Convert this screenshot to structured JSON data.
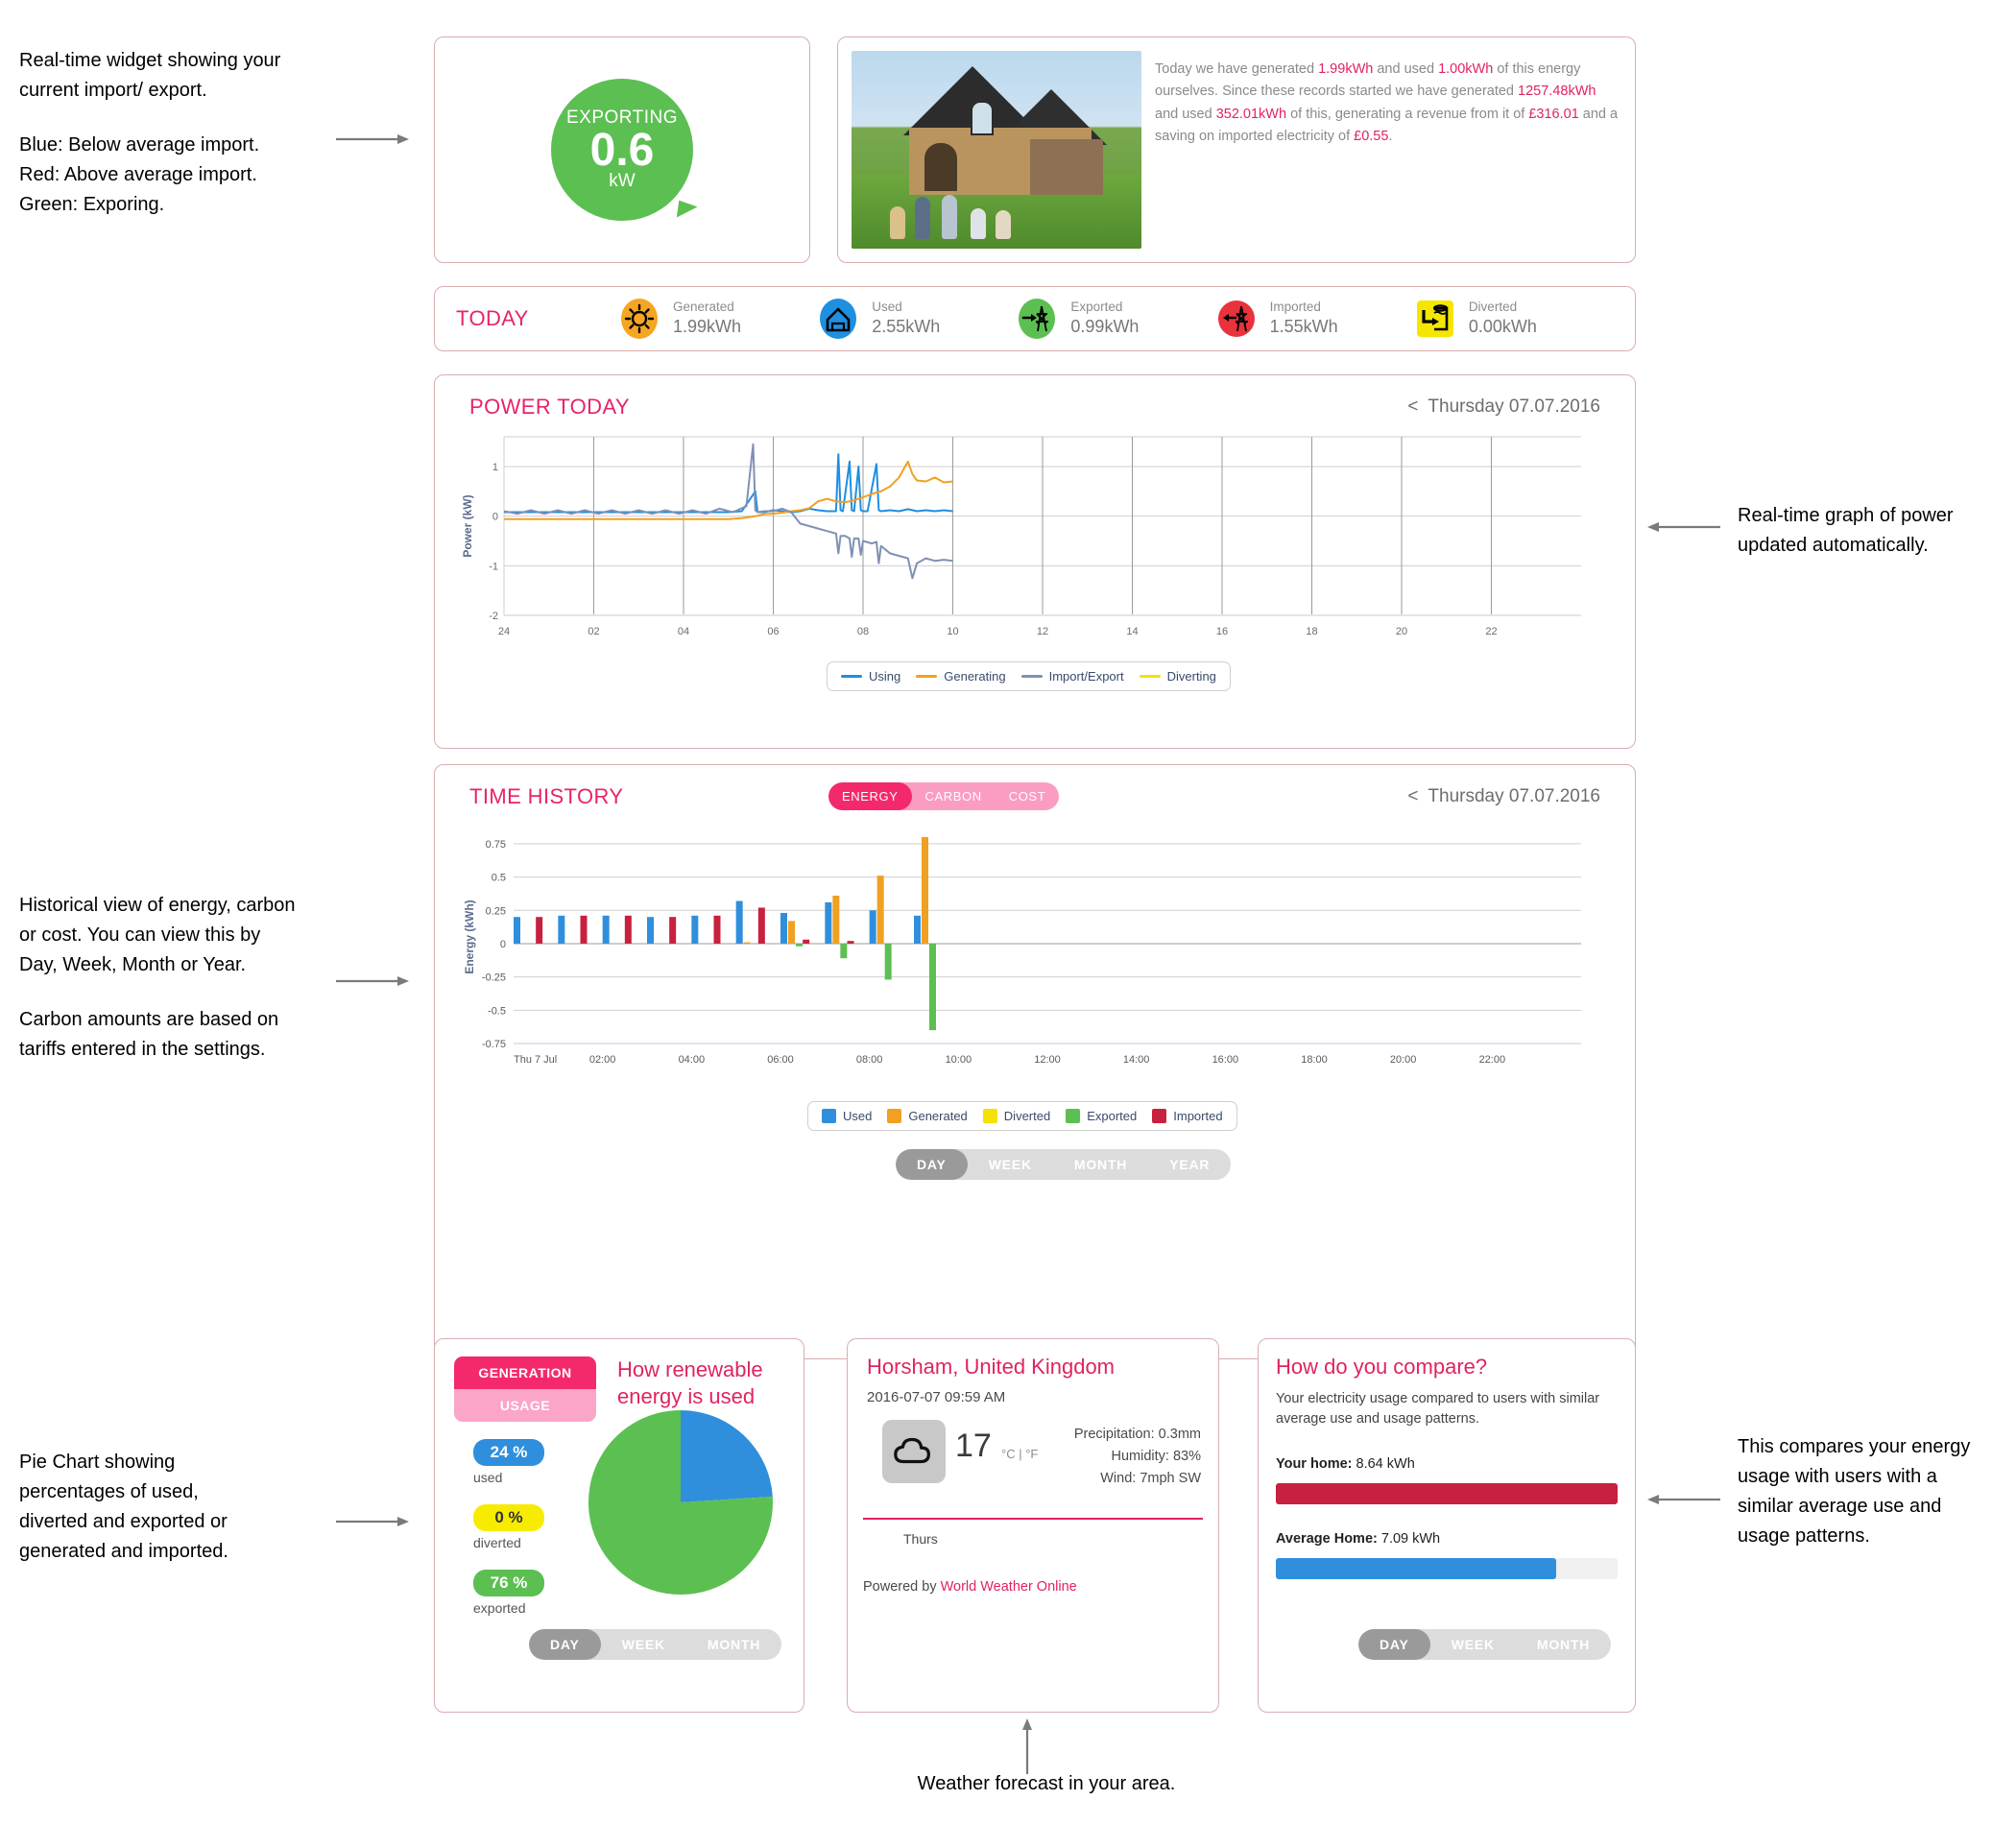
{
  "annotations": {
    "widget": [
      "Real-time widget showing your",
      "current import/ export.",
      "Blue: Below average import.",
      "Red: Above average import.",
      "Green: Exporing."
    ],
    "power_graph": [
      "Real-time graph of power",
      "updated automatically."
    ],
    "history": [
      "Historical view of energy, carbon",
      "or cost. You can view this by",
      "Day, Week, Month or Year.",
      "Carbon amounts are based on",
      "tariffs entered in the settings."
    ],
    "pie": [
      "Pie Chart showing",
      "percentages of used,",
      "diverted and exported or",
      "generated and imported."
    ],
    "compare": [
      "This compares your energy",
      "usage with users with a",
      "similar average use and",
      "usage patterns."
    ],
    "weather": "Weather forecast in your area."
  },
  "realtime": {
    "state": "EXPORTING",
    "value": "0.6",
    "unit": "kW",
    "color": "#5cbf52"
  },
  "summary": {
    "parts": [
      {
        "t": "Today we have generated ",
        "hl": false
      },
      {
        "t": "1.99kWh",
        "hl": true
      },
      {
        "t": " and used ",
        "hl": false
      },
      {
        "t": "1.00kWh",
        "hl": true
      },
      {
        "t": " of this energy ourselves. Since these records started we have generated ",
        "hl": false
      },
      {
        "t": "1257.48kWh",
        "hl": true
      },
      {
        "t": " and used ",
        "hl": false
      },
      {
        "t": "352.01kWh",
        "hl": true
      },
      {
        "t": " of this, generating a revenue from it of ",
        "hl": false
      },
      {
        "t": "£316.01",
        "hl": true
      },
      {
        "t": " and a saving on imported electricity of ",
        "hl": false
      },
      {
        "t": "£0.55",
        "hl": true
      },
      {
        "t": ".",
        "hl": false
      }
    ]
  },
  "today": {
    "title": "TODAY",
    "stats": [
      {
        "label": "Generated",
        "value": "1.99kWh",
        "icon": "sun-icon",
        "color": "#f5a623"
      },
      {
        "label": "Used",
        "value": "2.55kWh",
        "icon": "house-icon",
        "color": "#1f8fe0"
      },
      {
        "label": "Exported",
        "value": "0.99kWh",
        "icon": "pylon-export-icon",
        "color": "#5cbf52"
      },
      {
        "label": "Imported",
        "value": "1.55kWh",
        "icon": "pylon-import-icon",
        "color": "#e8323c"
      },
      {
        "label": "Diverted",
        "value": "0.00kWh",
        "icon": "tank-icon",
        "color": "#f5e600"
      }
    ]
  },
  "power_panel": {
    "title": "POWER TODAY",
    "date": "Thursday 07.07.2016",
    "chevron": "<"
  },
  "history_panel": {
    "title": "TIME HISTORY",
    "date": "Thursday 07.07.2016",
    "chevron": "<",
    "metric_tabs": [
      {
        "label": "ENERGY",
        "active": true
      },
      {
        "label": "CARBON",
        "active": false
      },
      {
        "label": "COST",
        "active": false
      }
    ],
    "range_tabs": [
      {
        "label": "DAY",
        "active": true
      },
      {
        "label": "WEEK",
        "active": false
      },
      {
        "label": "MONTH",
        "active": false
      },
      {
        "label": "YEAR",
        "active": false
      }
    ]
  },
  "pie_panel": {
    "tabs": [
      {
        "label": "GENERATION",
        "active": true
      },
      {
        "label": "USAGE",
        "active": false
      }
    ],
    "heading": [
      "How renewable",
      "energy is used"
    ],
    "items": [
      {
        "pct": "24 %",
        "label": "used",
        "color": "#2f8fdc",
        "text": "#ffffff"
      },
      {
        "pct": "0 %",
        "label": "diverted",
        "color": "#f7ec00",
        "text": "#333333"
      },
      {
        "pct": "76 %",
        "label": "exported",
        "color": "#5cbf52",
        "text": "#ffffff"
      }
    ],
    "range_tabs": [
      {
        "label": "DAY",
        "active": true
      },
      {
        "label": "WEEK",
        "active": false
      },
      {
        "label": "MONTH",
        "active": false
      }
    ]
  },
  "weather": {
    "location": "Horsham, United Kingdom",
    "timestamp": "2016-07-07 09:59 AM",
    "icon": "cloud-icon",
    "temperature": "17",
    "unit_c": "°C",
    "unit_sep": "|",
    "unit_f": "°F",
    "details": [
      "Precipitation: 0.3mm",
      "Humidity: 83%",
      "Wind: 7mph SW"
    ],
    "forecast_day": "Thurs",
    "powered_prefix": "Powered by ",
    "powered_link": "World Weather Online"
  },
  "compare": {
    "title": "How do you compare?",
    "subtitle": "Your electricity usage compared to users with similar average use and usage patterns.",
    "rows": [
      {
        "label": "Your home:",
        "value": "8.64 kWh",
        "pct": 100,
        "color": "#c8203f"
      },
      {
        "label": "Average Home:",
        "value": "7.09 kWh",
        "pct": 82,
        "color": "#2f8fdc"
      }
    ],
    "range_tabs": [
      {
        "label": "DAY",
        "active": true
      },
      {
        "label": "WEEK",
        "active": false
      },
      {
        "label": "MONTH",
        "active": false
      }
    ]
  },
  "chart_data": [
    {
      "type": "line",
      "title": "POWER TODAY",
      "xlabel": "",
      "ylabel": "Power (kW)",
      "ylim": [
        -2,
        1.6
      ],
      "yticks": [
        1,
        0,
        -1,
        -2
      ],
      "xticks": [
        "24",
        "02",
        "04",
        "06",
        "08",
        "10",
        "12",
        "14",
        "16",
        "18",
        "20",
        "22"
      ],
      "grid": true,
      "legend_position": "bottom",
      "series": [
        {
          "name": "Using",
          "color": "#1f8fe0",
          "x": [
            0,
            0.5,
            1,
            1.5,
            2,
            2.5,
            3,
            3.5,
            4,
            4.5,
            5,
            5.3,
            5.6,
            5.65,
            5.7,
            5.8,
            6,
            6.2,
            6.4,
            6.6,
            6.8,
            7,
            7.2,
            7.4,
            7.45,
            7.5,
            7.55,
            7.7,
            7.75,
            7.8,
            7.9,
            7.95,
            8,
            8.1,
            8.3,
            8.35,
            8.4,
            8.6,
            8.8,
            9,
            9.2,
            9.4,
            9.6,
            9.8,
            10
          ],
          "y": [
            0.08,
            0.08,
            0.08,
            0.08,
            0.08,
            0.08,
            0.08,
            0.08,
            0.08,
            0.08,
            0.08,
            0.1,
            0.5,
            0.08,
            0.08,
            0.08,
            0.12,
            0.1,
            0.08,
            0.1,
            0.15,
            0.12,
            0.1,
            0.1,
            1.25,
            0.12,
            0.1,
            1.1,
            0.12,
            0.1,
            1.0,
            0.12,
            0.1,
            0.1,
            1.05,
            0.12,
            0.1,
            0.12,
            0.1,
            0.14,
            0.1,
            0.12,
            0.1,
            0.12,
            0.1
          ]
        },
        {
          "name": "Generating",
          "color": "#f0a022",
          "x": [
            0,
            1,
            2,
            3,
            4,
            5,
            5.3,
            5.6,
            5.8,
            6,
            6.2,
            6.4,
            6.6,
            6.8,
            7,
            7.2,
            7.4,
            7.6,
            7.8,
            8,
            8.2,
            8.4,
            8.6,
            8.8,
            9,
            9.1,
            9.2,
            9.4,
            9.6,
            9.8,
            10
          ],
          "y": [
            -0.06,
            -0.06,
            -0.06,
            -0.06,
            -0.06,
            -0.06,
            -0.04,
            0.0,
            0.04,
            0.05,
            0.07,
            0.1,
            0.12,
            0.16,
            0.3,
            0.35,
            0.3,
            0.28,
            0.32,
            0.38,
            0.45,
            0.5,
            0.6,
            0.78,
            1.1,
            0.85,
            0.72,
            0.7,
            0.78,
            0.68,
            0.7
          ]
        },
        {
          "name": "Import/Export",
          "color": "#8090b5",
          "x": [
            0,
            0.3,
            0.6,
            0.9,
            1.2,
            1.5,
            1.8,
            2.1,
            2.4,
            2.7,
            3,
            3.3,
            3.6,
            3.9,
            4.2,
            4.5,
            4.8,
            5.1,
            5.4,
            5.55,
            5.6,
            5.65,
            5.8,
            6,
            6.2,
            6.4,
            6.6,
            6.8,
            7,
            7.2,
            7.4,
            7.45,
            7.5,
            7.6,
            7.7,
            7.75,
            7.8,
            7.9,
            7.95,
            8,
            8.2,
            8.3,
            8.35,
            8.4,
            8.6,
            8.8,
            9,
            9.1,
            9.2,
            9.4,
            9.6,
            9.8,
            10
          ],
          "y": [
            0.1,
            0.05,
            0.12,
            0.05,
            0.12,
            0.05,
            0.12,
            0.05,
            0.12,
            0.05,
            0.12,
            0.05,
            0.12,
            0.05,
            0.12,
            0.05,
            0.15,
            0.08,
            0.2,
            1.45,
            0.12,
            0.08,
            0.1,
            0.1,
            0.15,
            0.08,
            -0.15,
            -0.2,
            -0.25,
            -0.3,
            -0.35,
            -0.75,
            -0.4,
            -0.4,
            -0.45,
            -0.82,
            -0.45,
            -0.45,
            -0.78,
            -0.5,
            -0.55,
            -0.52,
            -0.95,
            -0.6,
            -0.75,
            -0.8,
            -0.85,
            -1.25,
            -0.95,
            -0.85,
            -0.9,
            -0.88,
            -0.9
          ]
        },
        {
          "name": "Diverting",
          "color": "#f5e200",
          "x": [],
          "y": []
        }
      ]
    },
    {
      "type": "bar",
      "title": "TIME HISTORY",
      "xlabel": "",
      "ylabel": "Energy (kWh)",
      "ylim": [
        -0.75,
        0.85
      ],
      "yticks": [
        0.75,
        0.5,
        0.25,
        0,
        -0.25,
        -0.5,
        -0.75
      ],
      "xticks": [
        "Thu 7 Jul",
        "02:00",
        "04:00",
        "06:00",
        "08:00",
        "10:00",
        "12:00",
        "14:00",
        "16:00",
        "18:00",
        "20:00",
        "22:00"
      ],
      "grid": true,
      "legend_position": "bottom",
      "categories": [
        "00:00",
        "00:30",
        "01:00",
        "01:30",
        "02:00",
        "02:30",
        "03:00",
        "03:30",
        "04:00",
        "04:30",
        "05:00",
        "05:30",
        "06:00",
        "06:30",
        "07:00",
        "07:30",
        "08:00",
        "08:30",
        "09:00"
      ],
      "series": [
        {
          "name": "Used",
          "color": "#2f8fdc",
          "values": [
            0.2,
            0,
            0.21,
            0,
            0.21,
            0,
            0.2,
            0,
            0.21,
            0,
            0.32,
            0,
            0.23,
            0,
            0.31,
            0,
            0.25,
            0,
            0.21
          ]
        },
        {
          "name": "Generated",
          "color": "#f0a022",
          "values": [
            0,
            0,
            0,
            0,
            0,
            0,
            0,
            0,
            0,
            0,
            0.01,
            0,
            0.17,
            0,
            0.36,
            0,
            0.51,
            0,
            0.8
          ]
        },
        {
          "name": "Diverted",
          "color": "#f5e200",
          "values": [
            0,
            0,
            0,
            0,
            0,
            0,
            0,
            0,
            0,
            0,
            0,
            0,
            0,
            0,
            0,
            0,
            0,
            0,
            0
          ]
        },
        {
          "name": "Exported",
          "color": "#5cbf52",
          "values": [
            0,
            0,
            0,
            0,
            0,
            0,
            0,
            0,
            0,
            0,
            0,
            0,
            -0.02,
            0,
            -0.11,
            0,
            -0.27,
            0,
            -0.65
          ]
        },
        {
          "name": "Imported",
          "color": "#c8203f",
          "values": [
            0,
            0.2,
            0,
            0.21,
            0,
            0.21,
            0,
            0.2,
            0,
            0.21,
            0,
            0.27,
            0,
            0.03,
            0,
            0.02,
            0,
            0,
            0
          ]
        }
      ]
    },
    {
      "type": "pie",
      "title": "How renewable energy is used",
      "labels": [
        "used",
        "diverted",
        "exported"
      ],
      "values": [
        24,
        0,
        76
      ],
      "colors": [
        "#2f8fdc",
        "#f7ec00",
        "#5cbf52"
      ]
    }
  ]
}
